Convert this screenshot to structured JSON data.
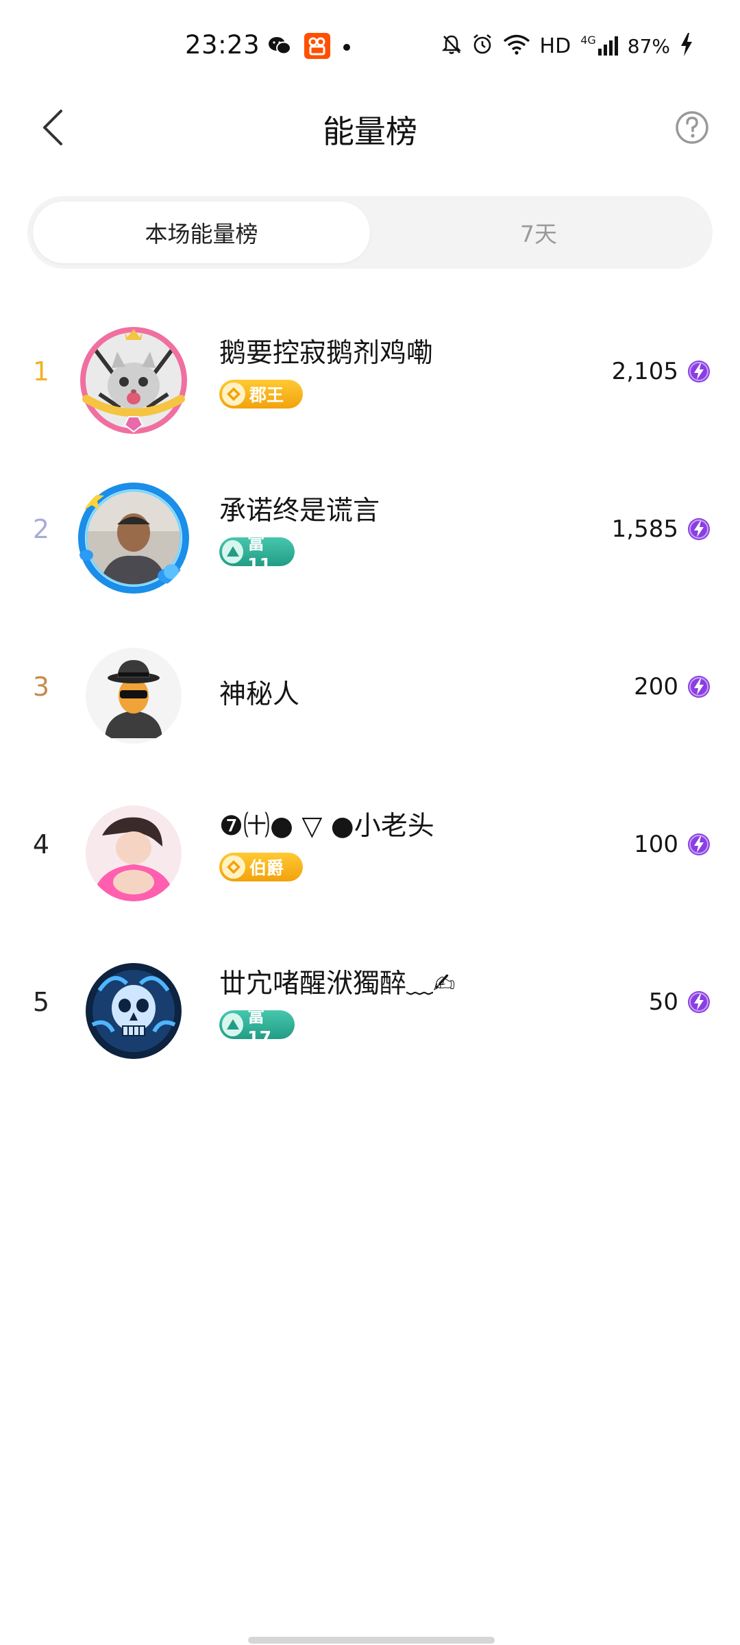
{
  "status_bar": {
    "time": "23:23",
    "network": "HD",
    "signal": "4G",
    "battery": "87%"
  },
  "header": {
    "title": "能量榜"
  },
  "tabs": [
    {
      "label": "本场能量榜",
      "active": true
    },
    {
      "label": "7天",
      "active": false
    }
  ],
  "ranking": [
    {
      "rank": "1",
      "rank_color": "#f0b323",
      "name": "鹅要控寂鹅剂鸡嘞",
      "badge": "郡王",
      "badge_type": "gold",
      "score": "2,105",
      "avatar": "cat-avatar"
    },
    {
      "rank": "2",
      "rank_color": "#a8abd9",
      "name": "承诺终是谎言",
      "badge": "富11",
      "badge_type": "teal",
      "score": "1,585",
      "avatar": "man-photo-avatar"
    },
    {
      "rank": "3",
      "rank_color": "#c58b4b",
      "name": "神秘人",
      "badge": "",
      "badge_type": "",
      "score": "200",
      "avatar": "mystery-man-avatar"
    },
    {
      "rank": "4",
      "rank_color": "#222222",
      "name": "❼㈩● ▽ ●小老头",
      "badge": "伯爵",
      "badge_type": "gold",
      "score": "100",
      "avatar": "woman-photo-avatar"
    },
    {
      "rank": "5",
      "rank_color": "#222222",
      "name": "丗宂啫醒洑獨醉﹏✍",
      "badge": "富17",
      "badge_type": "teal",
      "score": "50",
      "avatar": "skull-avatar"
    }
  ],
  "colors": {
    "energy_purple": "#8a3fe0",
    "badge_gold": "#f2a20c",
    "badge_teal": "#239c86"
  }
}
